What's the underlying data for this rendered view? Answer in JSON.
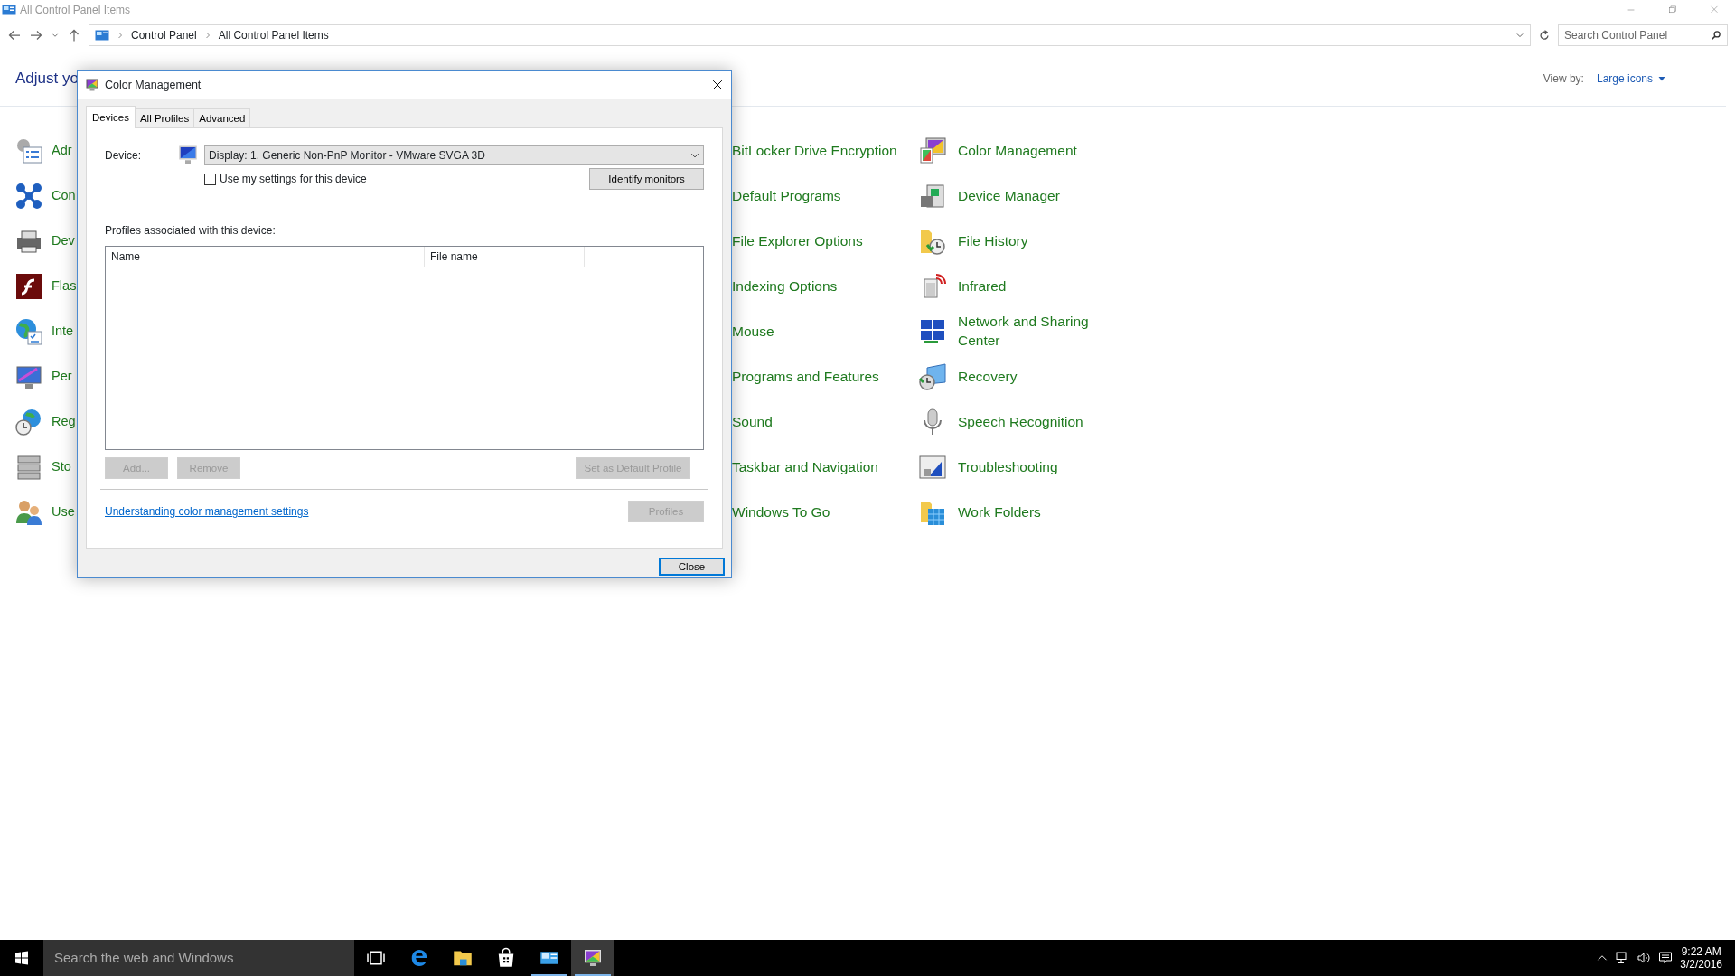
{
  "window": {
    "title": "All Control Panel Items"
  },
  "address": {
    "crumbs": [
      "Control Panel",
      "All Control Panel Items"
    ],
    "search_placeholder": "Search Control Panel"
  },
  "header": {
    "title": "Adjust yo",
    "view_by_label": "View by:",
    "view_by_value": "Large icons"
  },
  "column_1": [
    "Adr",
    "Con",
    "Dev",
    "Flas",
    "Inte",
    "Per",
    "Reg",
    "Sto",
    "Use"
  ],
  "column_2": [
    "BitLocker Drive Encryption",
    "Default Programs",
    "File Explorer Options",
    "Indexing Options",
    "Mouse",
    "Programs and Features",
    "Sound",
    "Taskbar and Navigation",
    "Windows To Go"
  ],
  "column_3": [
    "Color Management",
    "Device Manager",
    "File History",
    "Infrared",
    "Network and Sharing Center",
    "Recovery",
    "Speech Recognition",
    "Troubleshooting",
    "Work Folders"
  ],
  "dialog": {
    "title": "Color Management",
    "tabs": [
      {
        "label": "Devices",
        "selected": true
      },
      {
        "label": "All Profiles",
        "selected": false
      },
      {
        "label": "Advanced",
        "selected": false
      }
    ],
    "device_label": "Device:",
    "device_value": "Display: 1. Generic Non-PnP Monitor - VMware SVGA 3D",
    "checkbox": {
      "label": "Use my settings for this device",
      "checked": false
    },
    "identify_button": "Identify monitors",
    "profiles_label": "Profiles associated with this device:",
    "columns": [
      "Name",
      "File name"
    ],
    "buttons": [
      {
        "label": "Add...",
        "disabled": true
      },
      {
        "label": "Remove",
        "disabled": true
      },
      {
        "label": "Set as Default Profile",
        "disabled": true
      }
    ],
    "link": "Understanding color management settings",
    "profiles_button": {
      "label": "Profiles",
      "disabled": true
    },
    "close_button": "Close"
  },
  "taskbar": {
    "search_placeholder": "Search the web and Windows",
    "apps": [
      {
        "running": false,
        "active": false
      },
      {
        "running": false,
        "active": false
      },
      {
        "running": false,
        "active": false
      },
      {
        "running": false,
        "active": false
      },
      {
        "running": true,
        "active": false
      },
      {
        "running": true,
        "active": true
      }
    ],
    "time": "9:22 AM",
    "date": "3/2/2016"
  }
}
